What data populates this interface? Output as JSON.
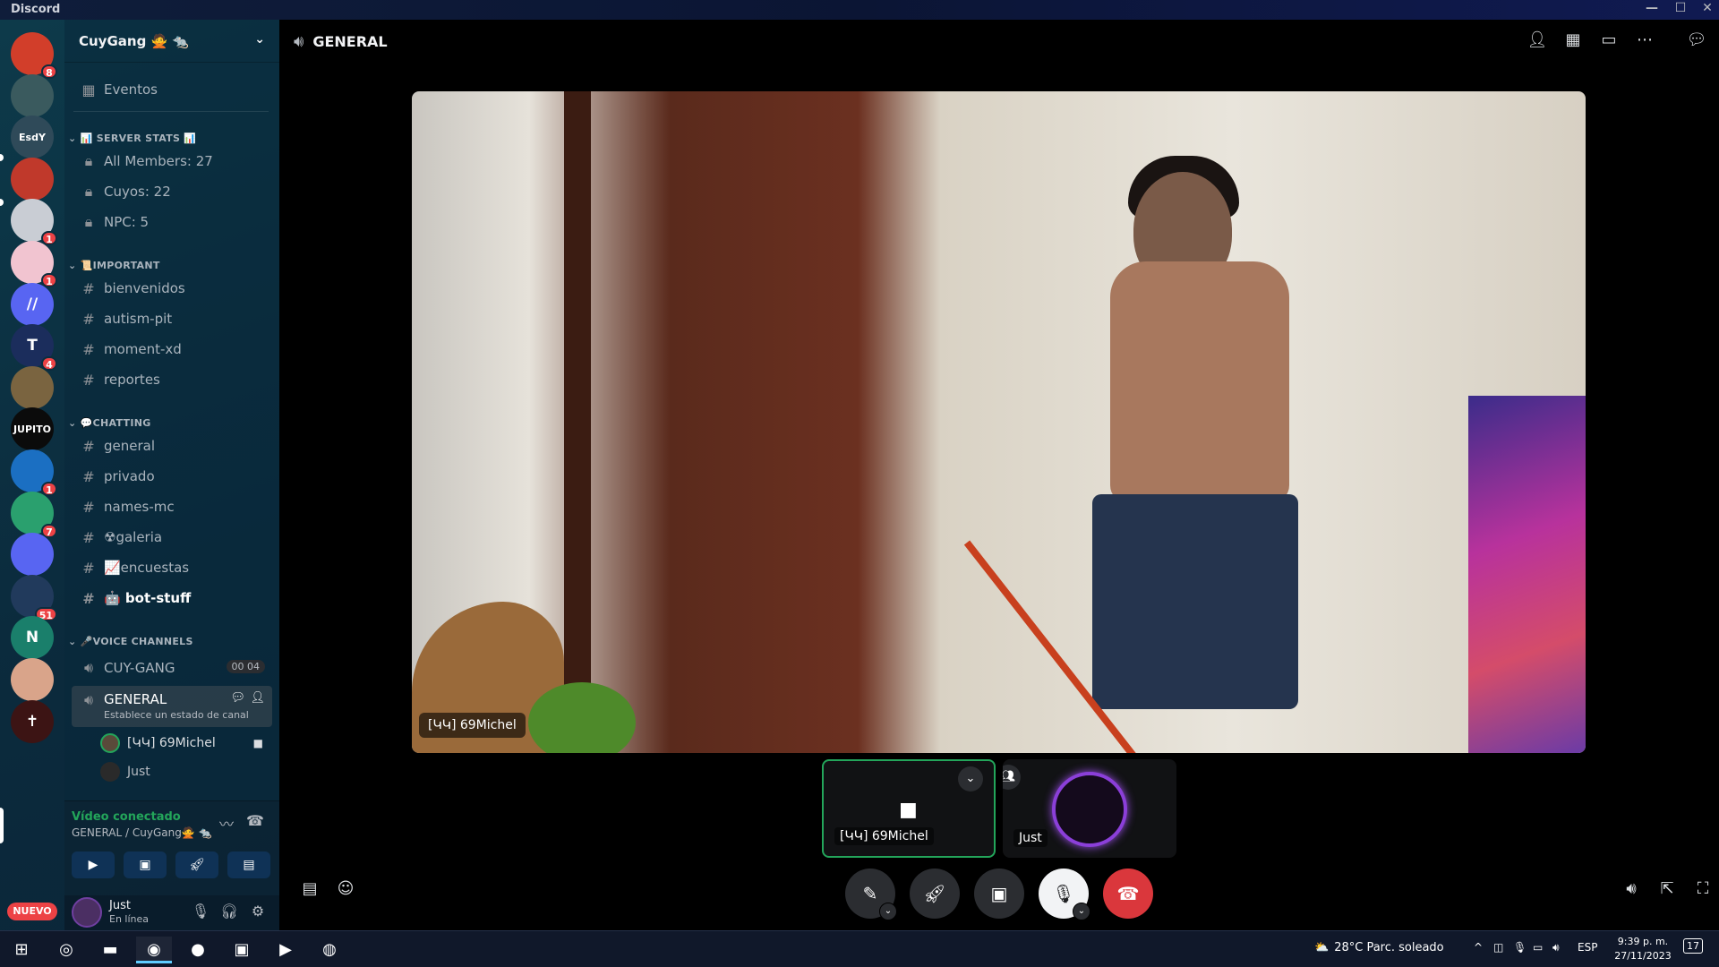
{
  "window": {
    "title": "Discord",
    "min": "—",
    "max": "☐",
    "close": "✕"
  },
  "server_list": [
    {
      "label": "",
      "badge": "8",
      "color": "#d23e2a"
    },
    {
      "label": "",
      "badge": "",
      "color": "#3a5a5e"
    },
    {
      "label": "EsdY",
      "badge": "",
      "color": "#2f4a59"
    },
    {
      "label": "",
      "badge": "",
      "color": "#c0392b"
    },
    {
      "label": "",
      "badge": "1",
      "color": "#c9cdd4"
    },
    {
      "label": "",
      "badge": "1",
      "color": "#f1c4d0"
    },
    {
      "label": "//",
      "badge": "",
      "color": "#5865f2"
    },
    {
      "label": "T",
      "badge": "4",
      "color": "#1b2d5c"
    },
    {
      "label": "",
      "badge": "",
      "color": "#7a6440"
    },
    {
      "label": "JUPITO",
      "badge": "",
      "color": "#0b0b0b"
    },
    {
      "label": "",
      "badge": "1",
      "color": "#1b6fc2"
    },
    {
      "label": "",
      "badge": "7",
      "color": "#2aa06e"
    },
    {
      "label": "",
      "badge": "",
      "color": "#5865f2"
    },
    {
      "label": "",
      "badge": "51",
      "color": "#213a5c"
    },
    {
      "label": "N",
      "badge": "",
      "color": "#1a7f6b"
    },
    {
      "label": "",
      "badge": "",
      "color": "#d9a48a"
    },
    {
      "label": "✝",
      "badge": "",
      "color": "#3c1414"
    }
  ],
  "nuevo_label": "NUEVO",
  "guild": {
    "name": "CuyGang 🙅 🐀",
    "events_label": "Eventos"
  },
  "categories": {
    "server_stats": "📊 SERVER STATS 📊",
    "important": "📜IMPORTANT",
    "chatting": "💬CHATTING",
    "voice": "🎤VOICE CHANNELS"
  },
  "channels": {
    "stats": [
      "All Members: 27",
      "Cuyos: 22",
      "NPC: 5"
    ],
    "important": [
      "bienvenidos",
      "autism-pit",
      "moment-xd",
      "reportes"
    ],
    "chatting": [
      "general",
      "privado",
      "names-mc",
      "☢galeria",
      "📈encuestas",
      "🤖 bot-stuff"
    ],
    "voice_cuy": "CUY-GANG",
    "voice_cuy_count": "00 04",
    "voice_general": "GENERAL",
    "voice_general_status": "Establece un estado de canal",
    "voice_users": [
      "[ԿԿ] 69Michel",
      "Just"
    ]
  },
  "rtc": {
    "status": "Vídeo conectado",
    "location": "GENERAL / CuyGang🙅 🐀"
  },
  "user": {
    "name": "Just",
    "status": "En línea"
  },
  "call": {
    "title": "GENERAL",
    "main_nametag": "[ԿԿ] 69Michel",
    "tiles": [
      "[ԿԿ] 69Michel",
      "Just"
    ]
  },
  "taskbar": {
    "weather": "28°C  Parc. soleado",
    "lang": "ESP",
    "time": "9:39 p. m.",
    "date": "27/11/2023",
    "notif": "17"
  }
}
